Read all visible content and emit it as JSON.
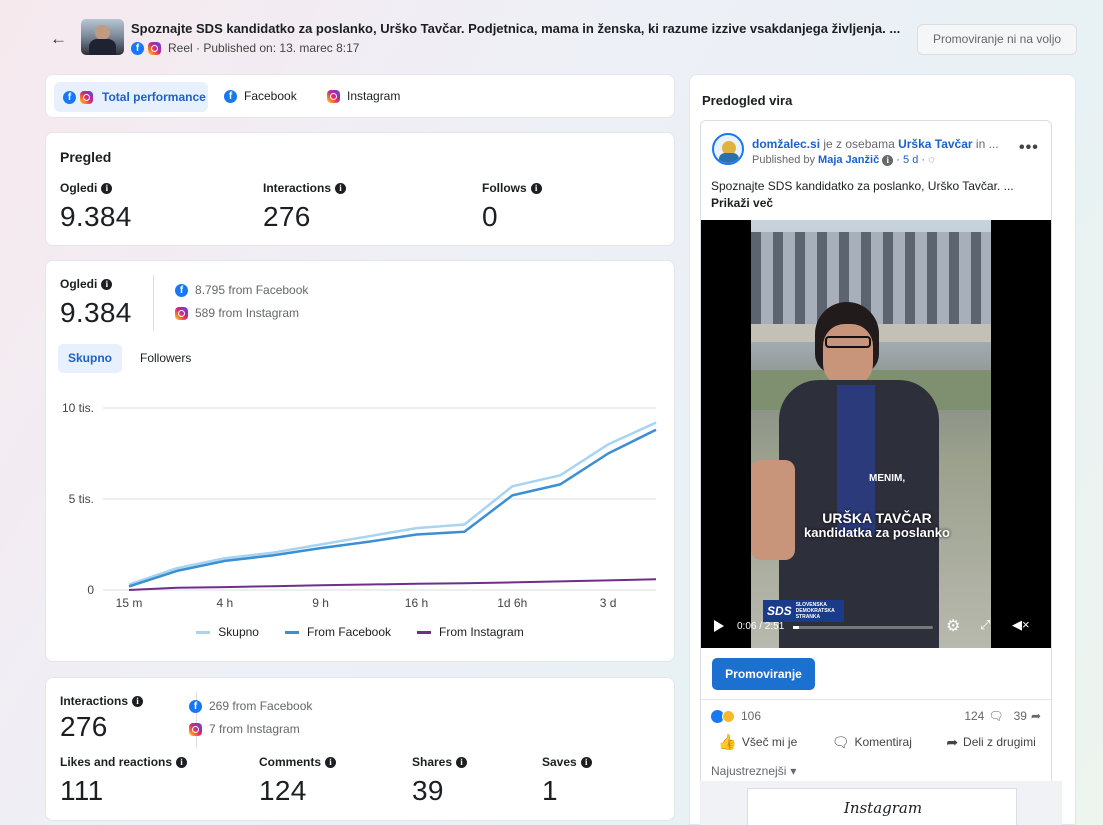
{
  "header": {
    "title": "Spoznajte SDS kandidatko za poslanko, Urško Tavčar. Podjetnica, mama in ženska, ki razume izzive vsakdanjega življenja. ...",
    "meta": "Reel · Published on: 13. marec 8:17",
    "promote_disabled": "Promoviranje ni na voljo"
  },
  "tabs": [
    "Total performance",
    "Facebook",
    "Instagram"
  ],
  "overview": {
    "title": "Pregled",
    "items": [
      {
        "label": "Ogledi",
        "value": "9.384"
      },
      {
        "label": "Interactions",
        "value": "276"
      },
      {
        "label": "Follows",
        "value": "0"
      }
    ]
  },
  "views": {
    "label": "Ogledi",
    "value": "9.384",
    "fb": "8.795 from Facebook",
    "ig": "589 from Instagram",
    "toggle": [
      "Skupno",
      "Followers"
    ]
  },
  "chart_data": {
    "type": "line",
    "x": [
      "15 m",
      "",
      "4 h",
      "",
      "9 h",
      "",
      "16 h",
      "",
      "1d 6h",
      "",
      "3 d",
      ""
    ],
    "xticks": [
      "15 m",
      "4 h",
      "9 h",
      "16 h",
      "1d 6h",
      "3 d"
    ],
    "yticks": [
      "0",
      "5 tis.",
      "10 tis."
    ],
    "ylim": [
      0,
      10000
    ],
    "series": [
      {
        "name": "Skupno",
        "color": "#a8d4f0",
        "values": [
          300,
          1200,
          1750,
          2050,
          2500,
          2950,
          3400,
          3600,
          5700,
          6300,
          8000,
          9200
        ]
      },
      {
        "name": "From Facebook",
        "color": "#3b8fd4",
        "values": [
          200,
          1050,
          1600,
          1900,
          2300,
          2650,
          3050,
          3200,
          5200,
          5800,
          7500,
          8800
        ]
      },
      {
        "name": "From Instagram",
        "color": "#6e2f87",
        "values": [
          0,
          120,
          160,
          210,
          260,
          300,
          340,
          370,
          420,
          470,
          530,
          590
        ]
      }
    ],
    "legend_position": "bottom",
    "grid": true
  },
  "interactions": {
    "label": "Interactions",
    "value": "276",
    "fb": "269 from Facebook",
    "ig": "7 from Instagram",
    "items": [
      {
        "label": "Likes and reactions",
        "value": "111"
      },
      {
        "label": "Comments",
        "value": "124"
      },
      {
        "label": "Shares",
        "value": "39"
      },
      {
        "label": "Saves",
        "value": "1"
      }
    ]
  },
  "preview": {
    "title": "Predogled vira",
    "page": "domžalec.si",
    "with_text": " je z osebama ",
    "person": "Urška Tavčar",
    "in_more": " in ...",
    "published_by": "Published by ",
    "author": "Maja Janžič",
    "time": " · 5 d · ",
    "caption": "Spoznajte SDS kandidatko za poslanko, Urško Tavčar. ...",
    "more": "Prikaži več",
    "video_text_1": "MENIM,",
    "video_name": "URŠKA TAVČAR",
    "video_role": "kandidatka za poslanko",
    "video_time": "0:06 / 2:51",
    "sds": "SDS",
    "sds_full": "SLOVENSKA DEMOKRATSKA STRANKA",
    "promote": "Promoviranje",
    "reactions": "106",
    "comments": "124",
    "shares": "39",
    "like": "Všeč mi je",
    "comment": "Komentiraj",
    "share": "Deli z drugimi",
    "sort": "Najustreznejši",
    "instagram": "Instagram"
  }
}
